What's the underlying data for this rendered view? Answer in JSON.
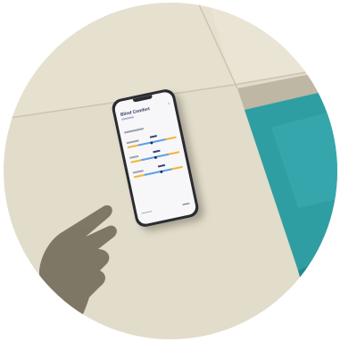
{
  "scene": {
    "colors": {
      "stone": "#e2dccb",
      "stone_light": "#e9e4d4",
      "joint": "#c9c2ac",
      "pool_water": "#2f9ea3",
      "pool_water_deep": "#1f7f87",
      "pool_edge": "#b9b3a0",
      "hand_shadow": "#6d6655",
      "phone_frame": "#2a2c30",
      "screen_bg": "#f7f7f9",
      "slider_orange": "#f2b43c",
      "slider_blue": "#5aa0e6",
      "knob": "#1f2a55"
    }
  },
  "phone": {
    "screen_title": "Blind Comfort"
  }
}
